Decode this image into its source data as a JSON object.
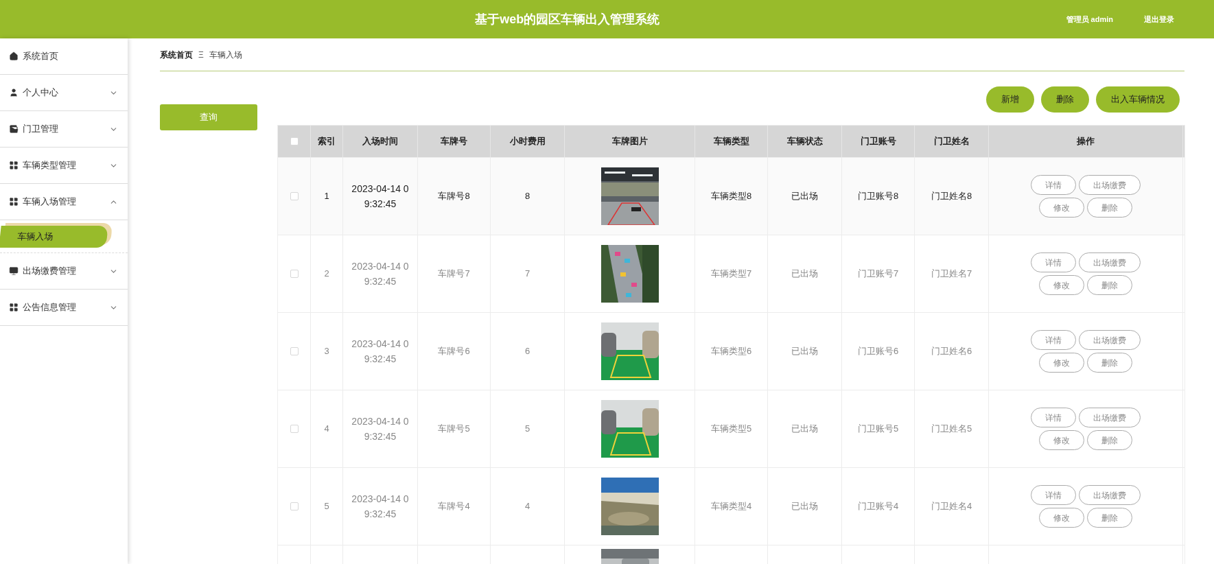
{
  "header": {
    "title": "基于web的园区车辆出入管理系统",
    "user": "管理员 admin",
    "logout": "退出登录"
  },
  "sidebar": {
    "items": [
      {
        "kind": "link",
        "label": "系统首页"
      },
      {
        "kind": "menu",
        "label": "个人中心",
        "expanded": false
      },
      {
        "kind": "menu",
        "label": "门卫管理",
        "expanded": false
      },
      {
        "kind": "menu",
        "label": "车辆类型管理",
        "expanded": false
      },
      {
        "kind": "menu",
        "label": "车辆入场管理",
        "expanded": true,
        "children": [
          {
            "label": "车辆入场",
            "selected": true
          }
        ]
      },
      {
        "kind": "menu",
        "label": "出场缴费管理",
        "expanded": false
      },
      {
        "kind": "menu",
        "label": "公告信息管理",
        "expanded": false
      }
    ]
  },
  "breadcrumb": {
    "home": "系统首页",
    "separator": "Ξ",
    "current": "车辆入场"
  },
  "search_button": "查询",
  "actions": [
    "新增",
    "删除",
    "出入车辆情况"
  ],
  "table": {
    "header_checked": false,
    "columns": [
      "索引",
      "入场时间",
      "车牌号",
      "小时费用",
      "车牌图片",
      "车辆类型",
      "车辆状态",
      "门卫账号",
      "门卫姓名",
      "操作"
    ],
    "rows": [
      {
        "checked": false,
        "hovered": true,
        "cells": [
          "1",
          "2023-04-14 09:32:45",
          "车牌号8",
          "8",
          {
            "kind": "picture"
          },
          "车辆类型8",
          "已出场",
          "门卫账号8",
          "门卫姓名8",
          [
            "详情",
            "出场缴费",
            "修改",
            "删除"
          ]
        ]
      },
      {
        "checked": false,
        "hovered": false,
        "cells": [
          "2",
          "2023-04-14 09:32:45",
          "车牌号7",
          "7",
          {
            "kind": "picture"
          },
          "车辆类型7",
          "已出场",
          "门卫账号7",
          "门卫姓名7",
          [
            "详情",
            "出场缴费",
            "修改",
            "删除"
          ]
        ]
      },
      {
        "checked": false,
        "hovered": false,
        "cells": [
          "3",
          "2023-04-14 09:32:45",
          "车牌号6",
          "6",
          {
            "kind": "picture"
          },
          "车辆类型6",
          "已出场",
          "门卫账号6",
          "门卫姓名6",
          [
            "详情",
            "出场缴费",
            "修改",
            "删除"
          ]
        ]
      },
      {
        "checked": false,
        "hovered": false,
        "cells": [
          "4",
          "2023-04-14 09:32:45",
          "车牌号5",
          "5",
          {
            "kind": "picture"
          },
          "车辆类型5",
          "已出场",
          "门卫账号5",
          "门卫姓名5",
          [
            "详情",
            "出场缴费",
            "修改",
            "删除"
          ]
        ]
      },
      {
        "checked": false,
        "hovered": false,
        "cells": [
          "5",
          "2023-04-14 09:32:45",
          "车牌号4",
          "4",
          {
            "kind": "picture"
          },
          "车辆类型4",
          "已出场",
          "门卫账号4",
          "门卫姓名4",
          [
            "详情",
            "出场缴费",
            "修改",
            "删除"
          ]
        ]
      }
    ],
    "partial_row": {
      "kind": "picture"
    }
  }
}
